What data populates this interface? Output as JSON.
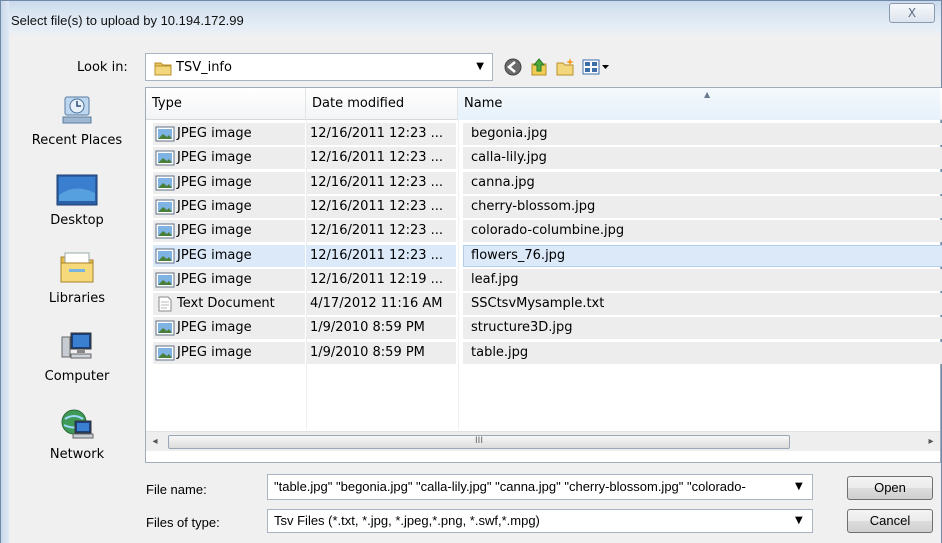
{
  "window": {
    "title": "Select file(s) to upload by 10.194.172.99",
    "close_label": "X"
  },
  "look_in": {
    "label": "Look in:",
    "value": "TSV_info"
  },
  "toolbar": {
    "icons": [
      "back-icon",
      "up-folder-icon",
      "new-folder-icon",
      "view-menu-icon"
    ]
  },
  "places": [
    {
      "label": "Recent Places",
      "icon": "recent-places-icon"
    },
    {
      "label": "Desktop",
      "icon": "desktop-icon"
    },
    {
      "label": "Libraries",
      "icon": "libraries-icon"
    },
    {
      "label": "Computer",
      "icon": "computer-icon"
    },
    {
      "label": "Network",
      "icon": "network-icon"
    }
  ],
  "columns": {
    "type": "Type",
    "date": "Date modified",
    "name": "Name",
    "sorted_by": "Name",
    "sort_direction": "ascending"
  },
  "files": [
    {
      "type": "JPEG image",
      "date": "12/16/2011 12:23 ...",
      "name": "begonia.jpg"
    },
    {
      "type": "JPEG image",
      "date": "12/16/2011 12:23 ...",
      "name": "calla-lily.jpg"
    },
    {
      "type": "JPEG image",
      "date": "12/16/2011 12:23 ...",
      "name": "canna.jpg"
    },
    {
      "type": "JPEG image",
      "date": "12/16/2011 12:23 ...",
      "name": "cherry-blossom.jpg"
    },
    {
      "type": "JPEG image",
      "date": "12/16/2011 12:23 ...",
      "name": "colorado-columbine.jpg"
    },
    {
      "type": "JPEG image",
      "date": "12/16/2011 12:23 ...",
      "name": "flowers_76.jpg",
      "focused": true
    },
    {
      "type": "JPEG image",
      "date": "12/16/2011 12:19 ...",
      "name": "leaf.jpg"
    },
    {
      "type": "Text Document",
      "date": "4/17/2012 11:16 AM",
      "name": "SSCtsvMysample.txt"
    },
    {
      "type": "JPEG image",
      "date": "1/9/2010 8:59 PM",
      "name": "structure3D.jpg"
    },
    {
      "type": "JPEG image",
      "date": "1/9/2010 8:59 PM",
      "name": "table.jpg"
    }
  ],
  "scrollbar": {
    "left_arrow": "◂",
    "right_arrow": "▸",
    "grip": "III"
  },
  "file_name": {
    "label": "File name:",
    "value": "\"table.jpg\" \"begonia.jpg\" \"calla-lily.jpg\" \"canna.jpg\" \"cherry-blossom.jpg\" \"colorado-"
  },
  "file_type": {
    "label": "Files of type:",
    "value": "Tsv Files (*.txt, *.jpg, *.jpeg,*.png, *.swf,*.mpg)"
  },
  "buttons": {
    "open": "Open",
    "cancel": "Cancel"
  },
  "colors": {
    "selection": "#dbe9f8",
    "row_bg": "#ededed",
    "accent": "#3c7fb1"
  }
}
